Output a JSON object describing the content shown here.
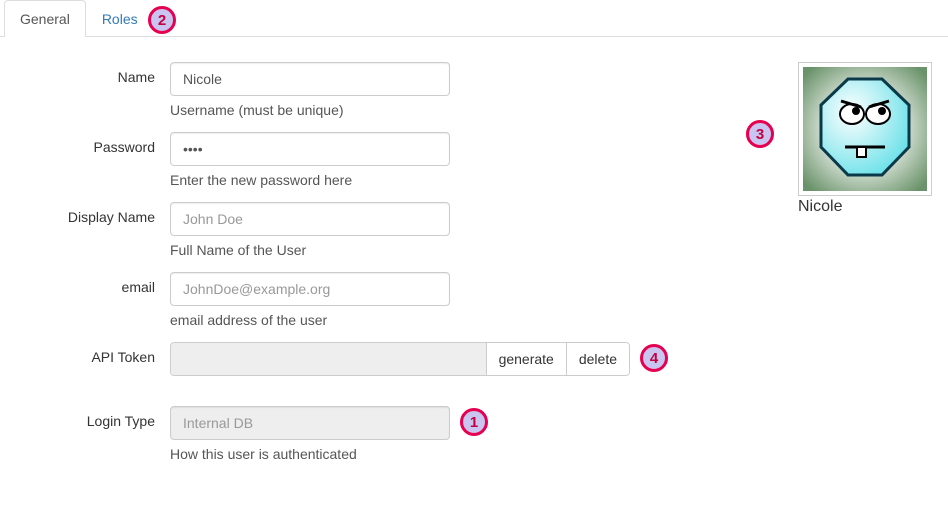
{
  "tabs": {
    "general": "General",
    "roles": "Roles"
  },
  "form": {
    "name": {
      "label": "Name",
      "value": "Nicole",
      "help": "Username (must be unique)"
    },
    "password": {
      "label": "Password",
      "value": "••••",
      "help": "Enter the new password here"
    },
    "display_name": {
      "label": "Display Name",
      "placeholder": "John Doe",
      "help": "Full Name of the User"
    },
    "email": {
      "label": "email",
      "placeholder": "JohnDoe@example.org",
      "help": "email address of the user"
    },
    "api_token": {
      "label": "API Token",
      "generate": "generate",
      "delete": "delete"
    },
    "login_type": {
      "label": "Login Type",
      "value": "Internal DB",
      "help": "How this user is authenticated"
    }
  },
  "avatar": {
    "name": "Nicole"
  },
  "markers": {
    "m1": "1",
    "m2": "2",
    "m3": "3",
    "m4": "4"
  }
}
